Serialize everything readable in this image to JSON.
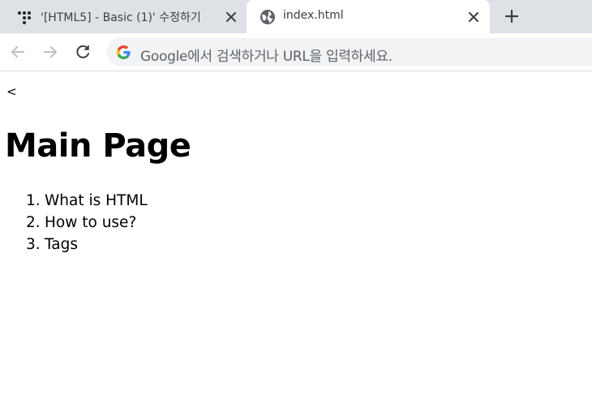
{
  "browser": {
    "tabs": [
      {
        "title": "'[HTML5] - Basic (1)' 수정하기",
        "favicon": "dots-logo-icon",
        "active": false
      },
      {
        "title": "index.html",
        "favicon": "globe-icon",
        "active": true
      }
    ],
    "omnibox_placeholder": "Google에서 검색하거나 URL을 입력하세요."
  },
  "page": {
    "stray_text": "<",
    "heading": "Main Page",
    "list": [
      {
        "num": "1.",
        "text": "What is HTML"
      },
      {
        "num": "2.",
        "text": "How to use?"
      },
      {
        "num": "3.",
        "text": "Tags"
      }
    ]
  }
}
